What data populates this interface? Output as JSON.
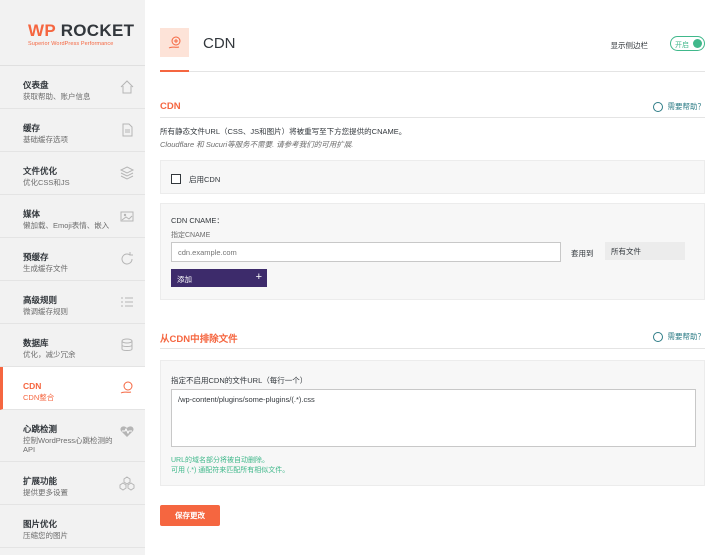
{
  "logo": {
    "wp": "WP",
    "rocket": " ROCKET",
    "tagline": "Superior WordPress Performance"
  },
  "sidebar": {
    "items": [
      {
        "title": "仪表盘",
        "sub": "获取帮助、账户信息"
      },
      {
        "title": "缓存",
        "sub": "基础缓存选项"
      },
      {
        "title": "文件优化",
        "sub": "优化CSS和JS"
      },
      {
        "title": "媒体",
        "sub": "懒加载、Emoji表情、嵌入"
      },
      {
        "title": "预缓存",
        "sub": "生成缓存文件"
      },
      {
        "title": "高级规则",
        "sub": "微调缓存规则"
      },
      {
        "title": "数据库",
        "sub": "优化，减少冗余"
      },
      {
        "title": "CDN",
        "sub": "CDN整合"
      },
      {
        "title": "心跳检测",
        "sub": "控制WordPress心跳检测的API"
      },
      {
        "title": "扩展功能",
        "sub": "提供更多设置"
      },
      {
        "title": "图片优化",
        "sub": "压缩您的图片"
      }
    ]
  },
  "header": {
    "title": "CDN",
    "sidebar_label": "显示侧边栏",
    "toggle_label": "开启"
  },
  "cdn_section": {
    "title": "CDN",
    "help": "需要帮助？",
    "desc1": "所有静态文件URL（CSS、JS和图片）将被重写至下方您提供的CNAME。",
    "desc2": "Cloudflare 和 Sucuri等服务不需要. 请参考我们的可用扩展.",
    "enable_label": "启用CDN",
    "cname_title": "CDN CNAME：",
    "cname_sub": "指定CNAME",
    "cname_placeholder": "cdn.example.com",
    "apply_label": "套用到",
    "apply_value": "所有文件",
    "add_button": "添加",
    "add_plus": "+"
  },
  "exclude_section": {
    "title": "从CDN中排除文件",
    "help": "需要帮助？",
    "field_label": "指定不启用CDN的文件URL（每行一个）",
    "textarea_value": "/wp-content/plugins/some-plugins/(.*).css",
    "note1": "URL的域名部分将被自动删除。",
    "note2": "可用 (.*) 通配符来匹配所有相似文件。"
  },
  "save_button": "保存更改",
  "colors": {
    "accent": "#f56640",
    "toggle": "#40b88b",
    "button": "#3d2b6b",
    "help": "#2d7c86"
  },
  "icons": [
    "home-icon",
    "file-icon",
    "layers-icon",
    "image-icon",
    "refresh-icon",
    "list-icon",
    "database-icon",
    "cdn-hand-icon",
    "heartbeat-icon",
    "addons-icon",
    "image-optimize-icon"
  ]
}
